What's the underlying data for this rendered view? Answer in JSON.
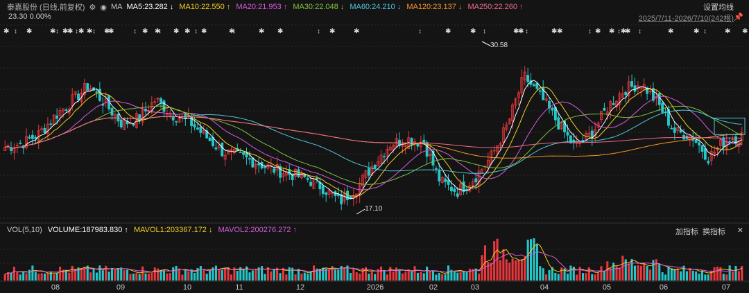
{
  "header": {
    "stock_name": "泰嘉股份 (日线,前复权)",
    "indicator_label": "MA",
    "ma_items": [
      {
        "label": "MA5:23.282 ↓",
        "color": "#ffffff"
      },
      {
        "label": "MA10:22.550 ↑",
        "color": "#f2d024"
      },
      {
        "label": "MA20:21.953 ↑",
        "color": "#d85be0"
      },
      {
        "label": "MA30:22.048 ↓",
        "color": "#7fc241"
      },
      {
        "label": "MA60:24.210 ↓",
        "color": "#4fc6d8"
      },
      {
        "label": "MA120:23.137 ↓",
        "color": "#f5962a"
      },
      {
        "label": "MA250:22.260 ↑",
        "color": "#f06b8a"
      }
    ],
    "price_line": "23.30 0.00%",
    "settings_label": "设置均线",
    "date_range": "2025/7/11-2026/7/10(242根)"
  },
  "volume_header": {
    "name": "VOL(5,10)",
    "volume": "VOLUME:187983.830 ↑",
    "mavol1": "MAVOL1:203367.172 ↓",
    "mavol2": "MAVOL2:200276.272 ↑",
    "tool_add": "加指标",
    "tool_switch": "换指标",
    "close": "✕"
  },
  "chart_data": {
    "type": "candlestick",
    "annotations": [
      {
        "label": "30.58",
        "kind": "high"
      },
      {
        "label": "17.10",
        "kind": "low"
      }
    ],
    "x_ticks": [
      "08",
      "09",
      "10",
      "11",
      "12",
      "2026",
      "02",
      "03",
      "04",
      "05",
      "06",
      "07"
    ],
    "approx_close_path": [
      22.3,
      22.6,
      23.4,
      25.0,
      26.3,
      27.6,
      26.0,
      24.3,
      24.8,
      26.4,
      25.1,
      24.5,
      23.2,
      21.9,
      21.5,
      21.0,
      20.4,
      20.0,
      19.6,
      18.8,
      17.6,
      18.8,
      20.8,
      22.6,
      23.0,
      22.7,
      19.3,
      18.5,
      19.6,
      21.4,
      24.2,
      28.4,
      26.6,
      24.4,
      22.3,
      23.4,
      25.8,
      27.3,
      27.8,
      26.0,
      23.6,
      23.3,
      21.4,
      22.9,
      23.3
    ],
    "colors": {
      "up": "#e8383d",
      "down": "#26c6c9",
      "high_low_marker": "#ffffff"
    }
  }
}
